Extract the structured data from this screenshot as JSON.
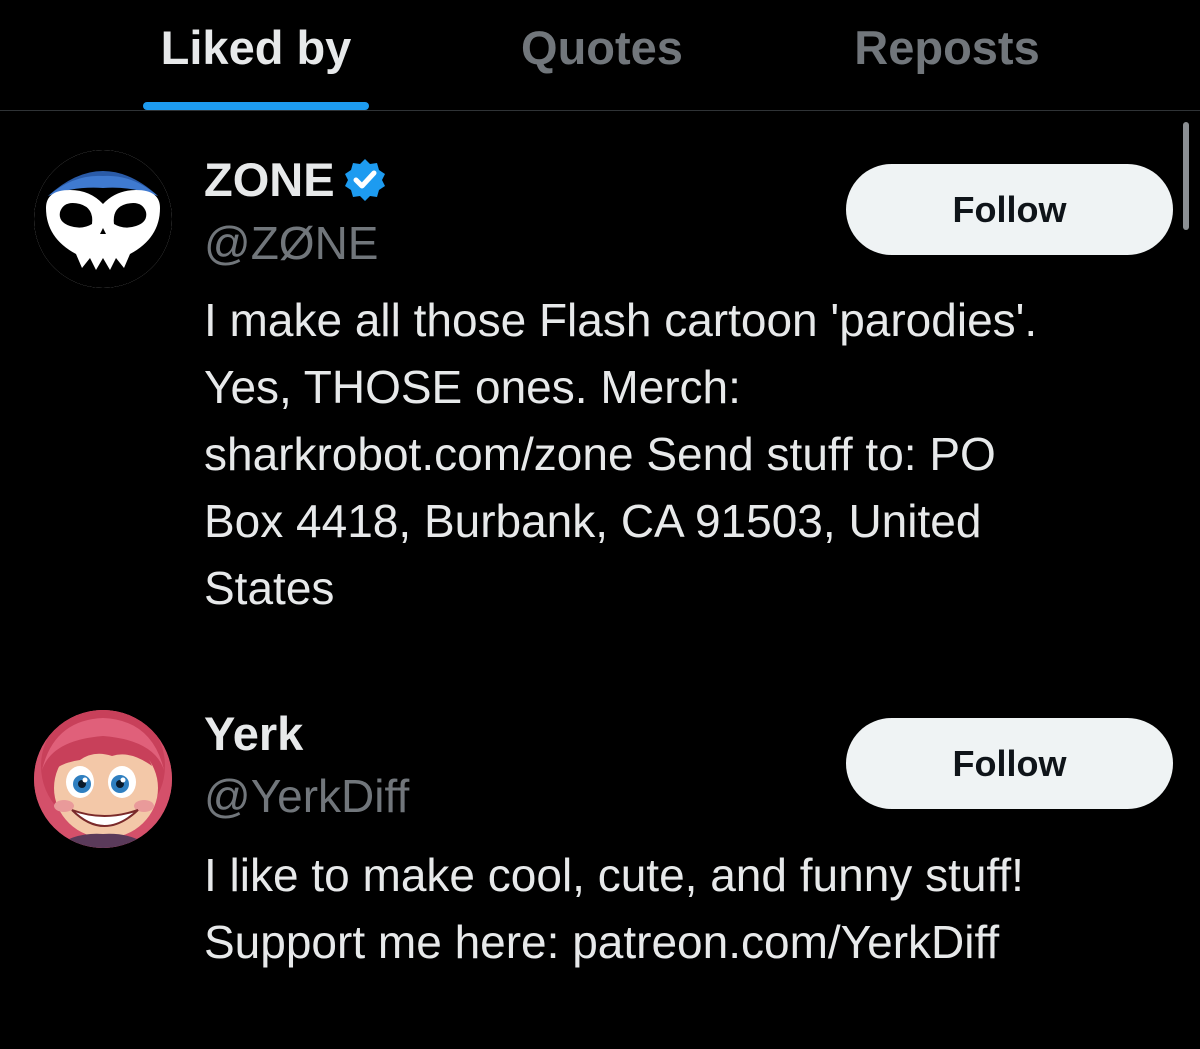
{
  "tabs": [
    {
      "label": "Liked by",
      "active": true
    },
    {
      "label": "Quotes",
      "active": false
    },
    {
      "label": "Reposts",
      "active": false
    }
  ],
  "users": [
    {
      "display_name": "ZONE",
      "verified": true,
      "handle": "@ZØNE",
      "bio_lines": [
        "I make all those Flash cartoon 'parodies'.",
        "Yes, THOSE ones. Merch:",
        "sharkrobot.com/zone Send stuff to: PO",
        "Box 4418, Burbank, CA 91503, United",
        "States"
      ],
      "follow_label": "Follow",
      "avatar_icon": "zone-skull-logo"
    },
    {
      "display_name": "Yerk",
      "verified": false,
      "handle": "@YerkDiff",
      "bio_lines": [
        "I like to make cool, cute, and funny stuff!",
        "Support me here: patreon.com/YerkDiff"
      ],
      "follow_label": "Follow",
      "avatar_icon": "cartoon-girl-avatar"
    }
  ],
  "colors": {
    "background": "#000000",
    "accent": "#1d9bf0",
    "text_primary": "#e7e9ea",
    "text_secondary": "#71767b",
    "follow_bg": "#eff3f4"
  }
}
